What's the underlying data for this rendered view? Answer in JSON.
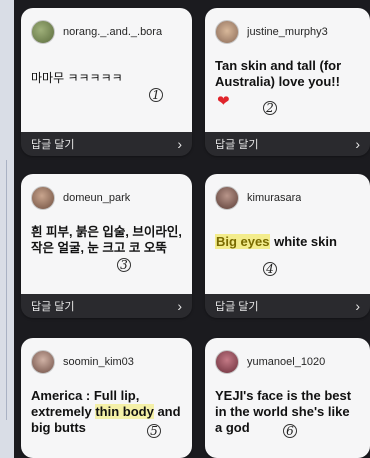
{
  "reply_label": "답글 달기",
  "colors": {
    "accent_heart": "#e0242b",
    "reply_bar": "#2a2a2e",
    "card_bg": "#f6f6f7"
  },
  "cards": [
    {
      "username": "norang._.and._.bora",
      "message": "마마무 ㅋㅋㅋㅋㅋ",
      "number": "1"
    },
    {
      "username": "justine_murphy3",
      "message": "Tan skin and tall (for Australia) love you!!",
      "number": "2"
    },
    {
      "username": "domeun_park",
      "message": "흰 피부, 붉은 입술, 브이라인, 작은 얼굴, 눈 크고 코 오뚝",
      "number": "3"
    },
    {
      "username": "kimurasara",
      "message_part1": "Big eyes",
      "message_part2": " white skin",
      "number": "4"
    },
    {
      "username": "soomin_kim03",
      "message_part1": "America : Full lip, extremely ",
      "message_part2": "thin body",
      "message_part3": " and big butts",
      "number": "5"
    },
    {
      "username": "yumanoel_1020",
      "message": "YEJI's face is the best in the world she's like a god",
      "number": "6"
    }
  ]
}
